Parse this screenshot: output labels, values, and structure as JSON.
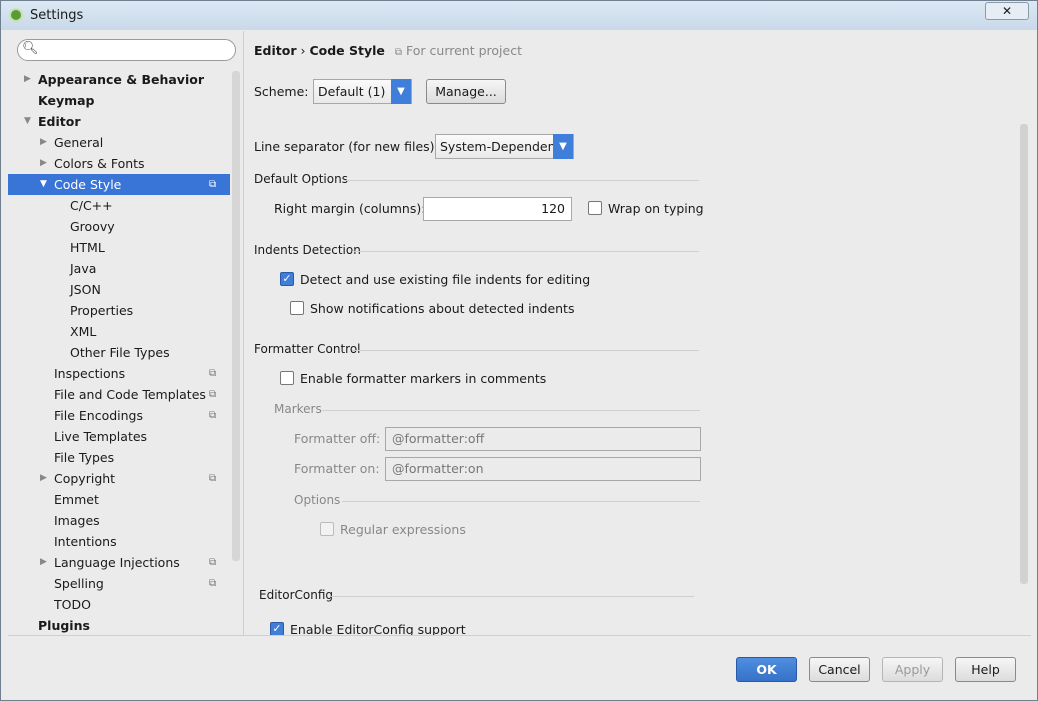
{
  "window": {
    "title": "Settings",
    "close": "✕"
  },
  "sidebar": {
    "search_placeholder": "",
    "items": [
      {
        "label": "Appearance & Behavior",
        "level": 0,
        "bold": true,
        "arrow": "right"
      },
      {
        "label": "Keymap",
        "level": 0,
        "bold": true
      },
      {
        "label": "Editor",
        "level": 0,
        "bold": true,
        "arrow": "down"
      },
      {
        "label": "General",
        "level": 1,
        "arrow": "right"
      },
      {
        "label": "Colors & Fonts",
        "level": 1,
        "arrow": "right"
      },
      {
        "label": "Code Style",
        "level": 1,
        "arrow": "down",
        "selected": true,
        "project": true
      },
      {
        "label": "C/C++",
        "level": 2
      },
      {
        "label": "Groovy",
        "level": 2
      },
      {
        "label": "HTML",
        "level": 2
      },
      {
        "label": "Java",
        "level": 2
      },
      {
        "label": "JSON",
        "level": 2
      },
      {
        "label": "Properties",
        "level": 2
      },
      {
        "label": "XML",
        "level": 2
      },
      {
        "label": "Other File Types",
        "level": 2
      },
      {
        "label": "Inspections",
        "level": 1,
        "project": true
      },
      {
        "label": "File and Code Templates",
        "level": 1,
        "project": true
      },
      {
        "label": "File Encodings",
        "level": 1,
        "project": true
      },
      {
        "label": "Live Templates",
        "level": 1
      },
      {
        "label": "File Types",
        "level": 1
      },
      {
        "label": "Copyright",
        "level": 1,
        "arrow": "right",
        "project": true
      },
      {
        "label": "Emmet",
        "level": 1
      },
      {
        "label": "Images",
        "level": 1
      },
      {
        "label": "Intentions",
        "level": 1
      },
      {
        "label": "Language Injections",
        "level": 1,
        "arrow": "right",
        "project": true
      },
      {
        "label": "Spelling",
        "level": 1,
        "project": true
      },
      {
        "label": "TODO",
        "level": 1
      },
      {
        "label": "Plugins",
        "level": 0,
        "bold": true
      }
    ]
  },
  "main": {
    "breadcrumb": {
      "parent": "Editor",
      "sep": "›",
      "current": "Code Style",
      "scope": "For current project"
    },
    "scheme": {
      "label": "Scheme:",
      "value": "Default (1)",
      "manage": "Manage..."
    },
    "line_separator": {
      "label": "Line separator (for new files):",
      "value": "System-Dependent"
    },
    "default_options": {
      "title": "Default Options",
      "right_margin_label": "Right margin (columns):",
      "right_margin": "120",
      "wrap_label": "Wrap on typing",
      "wrap": false
    },
    "indents": {
      "title": "Indents Detection",
      "detect_label": "Detect and use existing file indents for editing",
      "detect": true,
      "notify_label": "Show notifications about detected indents",
      "notify": false
    },
    "formatter": {
      "title": "Formatter Control",
      "enable_label": "Enable formatter markers in comments",
      "enable": false,
      "markers_title": "Markers",
      "off_label": "Formatter off:",
      "off_value": "@formatter:off",
      "on_label": "Formatter on:",
      "on_value": "@formatter:on",
      "options_title": "Options",
      "regex_label": "Regular expressions",
      "regex": false
    },
    "editorconfig": {
      "title": "EditorConfig",
      "enable_label": "Enable EditorConfig support",
      "enable": true
    }
  },
  "buttons": {
    "ok": "OK",
    "cancel": "Cancel",
    "apply": "Apply",
    "help": "Help"
  },
  "colors": {
    "accent": "#3875d7"
  }
}
